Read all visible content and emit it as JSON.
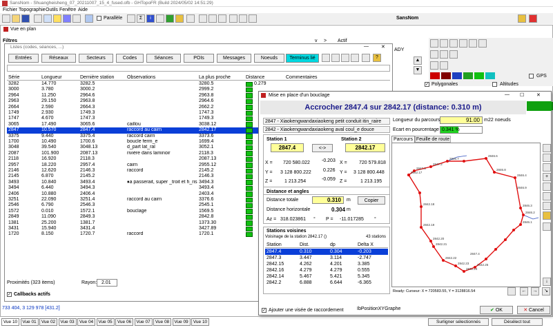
{
  "app": {
    "title": "SansNom - Shuangheisheng_07_20211007_15_4_fused.ofb - GHTopoFR (Build 2024/05/02 14:51:29)",
    "right_title": "SansNom"
  },
  "menu": [
    "Fichier",
    "Topographie",
    "Outils",
    "Fenêtre",
    "Aide"
  ],
  "toolbar": {
    "parallele": "Parallèle"
  },
  "plan_window": {
    "title": "Vue en plan",
    "filtres": "Filtres",
    "actif": "Actif",
    "v": "v",
    "gt": ">",
    "ady": "ADY",
    "polygonales": "Polygonales",
    "altitudes": "Altitudes",
    "gps": "GPS"
  },
  "lists_window": {
    "title": "Listes (codes, séances, ...)",
    "tabs": [
      "Entrées",
      "Réseaux",
      "Secteurs",
      "Codes",
      "Séances",
      "POIs",
      "Messages",
      "Noeuds",
      "Terminus lié"
    ],
    "columns": [
      "Série",
      "Longueur",
      "Dernière station",
      "Observations",
      "La plus proche",
      "Distance",
      "Commentaires"
    ],
    "rows": [
      [
        "3282",
        "14.770",
        "3282.5",
        "",
        "3280.5",
        "0.279"
      ],
      [
        "3000",
        "3.780",
        "3000.2",
        "",
        "2999.2",
        ""
      ],
      [
        "2964",
        "11.250",
        "2964.6",
        "",
        "2963.8",
        ""
      ],
      [
        "2963",
        "29.150",
        "2963.8",
        "",
        "2964.6",
        ""
      ],
      [
        "2664",
        "2.590",
        "2664.3",
        "",
        "2662.2",
        ""
      ],
      [
        "1749",
        "2.930",
        "1749.3",
        "",
        "1747.3",
        ""
      ],
      [
        "1747",
        "4.670",
        "1747.3",
        "",
        "1749.3",
        ""
      ],
      [
        "3065",
        "17.490",
        "3065.6",
        "caillou",
        "3038.12",
        ""
      ],
      [
        "2847",
        "10.570",
        "2847.4",
        "raccord au cairn",
        "2842.17",
        ""
      ],
      [
        "3375",
        "9.440",
        "3375.4",
        "raccord cairn",
        "3373.6",
        ""
      ],
      [
        "1700",
        "10.490",
        "1700.6",
        "boucle ferm_e",
        "1699.4",
        ""
      ],
      [
        "3048",
        "39.540",
        "3048.13",
        "d_part lat_ral",
        "3052.1",
        ""
      ],
      [
        "2087",
        "101.900",
        "2087.13",
        "rivière dans laminoir",
        "2118.3",
        ""
      ],
      [
        "2118",
        "16.920",
        "2118.3",
        "",
        "2087.13",
        ""
      ],
      [
        "2957",
        "18.220",
        "2957.4",
        "cairn",
        "2955.12",
        ""
      ],
      [
        "2146",
        "12.620",
        "2146.3",
        "raccord",
        "2145.2",
        ""
      ],
      [
        "2145",
        "6.870",
        "2145.2",
        "",
        "2146.3",
        ""
      ],
      [
        "3493",
        "10.840",
        "3493.4",
        "♦a passerait, super _troit et h_ris",
        "3494.3",
        ""
      ],
      [
        "3494",
        "6.440",
        "3494.3",
        "",
        "3493.4",
        ""
      ],
      [
        "2406",
        "10.880",
        "2406.4",
        "",
        "2403.4",
        ""
      ],
      [
        "3251",
        "22.090",
        "3251.4",
        "raccord au cairn",
        "3376.6",
        ""
      ],
      [
        "2546",
        "6.790",
        "2546.3",
        "",
        "2545.1",
        ""
      ],
      [
        "1572",
        "0.010",
        "1572.1",
        "bouclage",
        "1569.5",
        ""
      ],
      [
        "2849",
        "11.090",
        "2849.3",
        "",
        "2842.8",
        ""
      ],
      [
        "1381",
        "25.200",
        "1381.7",
        "",
        "1373.30",
        ""
      ],
      [
        "3431",
        "15.940",
        "3431.4",
        "",
        "3427.89",
        ""
      ],
      [
        "1720",
        "8.150",
        "1720.7",
        "raccord",
        "1720.1",
        ""
      ]
    ],
    "proximites": "Proximités (323 items)",
    "rayon_label": "Rayon:",
    "rayon_value": "2.01",
    "callbacks": "Callbacks actifs"
  },
  "status_coords": "733 404, 3 129 978 [431.2]",
  "view_tabs": [
    "Vue 10",
    "Vue 01",
    "Vue 02",
    "Vue 03",
    "Vue 04",
    "Vue 05",
    "Vue 06",
    "Vue 07",
    "Vue 08",
    "Vue 09",
    "Vue 10"
  ],
  "bottom": {
    "surligner": "Surligner sélectionnés",
    "deselect": "Désélect tout"
  },
  "dialog": {
    "title": "Mise en place d'un bouclage",
    "heading": "Accrocher 2847.4 sur 2842.17 (distance: 0.310 m)",
    "serie1": "2847 - Xiaokengwandaxiaokeng petit conduit itin_raire",
    "serie2": "2842 - Xiaokengwandaxiaokeng aval coul_e douce",
    "station1_label": "Station 1",
    "station1": "2847.4",
    "swap": "<->",
    "station2_label": "Station 2",
    "station2": "2842.17",
    "x": "X =",
    "y": "Y =",
    "z": "Z =",
    "x1": "720 580.022",
    "y1": "3 128 800.222",
    "z1": "1 213.254",
    "dx": "-0.203",
    "dy": "0.226",
    "dz": "-0.059",
    "x2": "720 579.818",
    "y2": "3 128 800.448",
    "z2": "1 213.195",
    "dist_title": "Distance et angles",
    "dist_totale_label": "Distance totale",
    "dist_totale": "0.310",
    "m": "m",
    "copier": "Copier",
    "dist_horiz_label": "Distance horizontale",
    "dist_horiz": "0.304",
    "az_label": "Az =",
    "az": "318.023861",
    "deg": "°",
    "p_label": "P =",
    "p": "-11.017285",
    "voisines_title": "Stations voisines",
    "voisinage": "Voisinage de la station 2842.17 ()",
    "nb_stations": "43 stations",
    "voisines_cols": [
      "Station",
      "Dist.",
      "dp",
      "Delta X"
    ],
    "voisines": [
      [
        "2847.4",
        "0.310",
        "0.304",
        "-0.203"
      ],
      [
        "2847.3",
        "3.447",
        "3.114",
        "-2.747"
      ],
      [
        "2842.15",
        "4.262",
        "4.201",
        "3.385"
      ],
      [
        "2842.16",
        "4.279",
        "4.279",
        "0.555"
      ],
      [
        "2842.14",
        "5.467",
        "5.421",
        "5.345"
      ],
      [
        "2842.2",
        "6.888",
        "6.644",
        "-6.365"
      ]
    ],
    "longueur_label": "Longueur du parcours",
    "longueur": "91.00",
    "noeuds": "22 noeuds",
    "ecart_label": "Ecart en pourcentage",
    "ecart": "0.341 %",
    "tab_parcours": "Parcours",
    "tab_feuille": "Feuille de route",
    "cursor": "Ready: Curseur: X = 720583.55, Y = 3128816.54",
    "viseee": "Ajouter une visée de raccordement",
    "ib": "IbPositionXYGraphe",
    "ok": "OK",
    "cancel": "Cancel",
    "graph_labels": [
      "2847.3",
      "2842.17",
      "2847.4",
      "2847.2",
      "2846.7",
      "2846.6",
      "2846.8",
      "2846.4",
      "2846.3",
      "2846.2",
      "2846.1",
      "2842.18",
      "2842.19",
      "2842.20",
      "2842.21",
      "2842.22",
      "2842.23",
      "2842.24",
      "2842.25",
      "2846.9"
    ]
  },
  "colors": {
    "accent": "#0a3fd8",
    "green": "#10c010",
    "route": "#e01010",
    "heading_blue": "#1a1a8a"
  }
}
